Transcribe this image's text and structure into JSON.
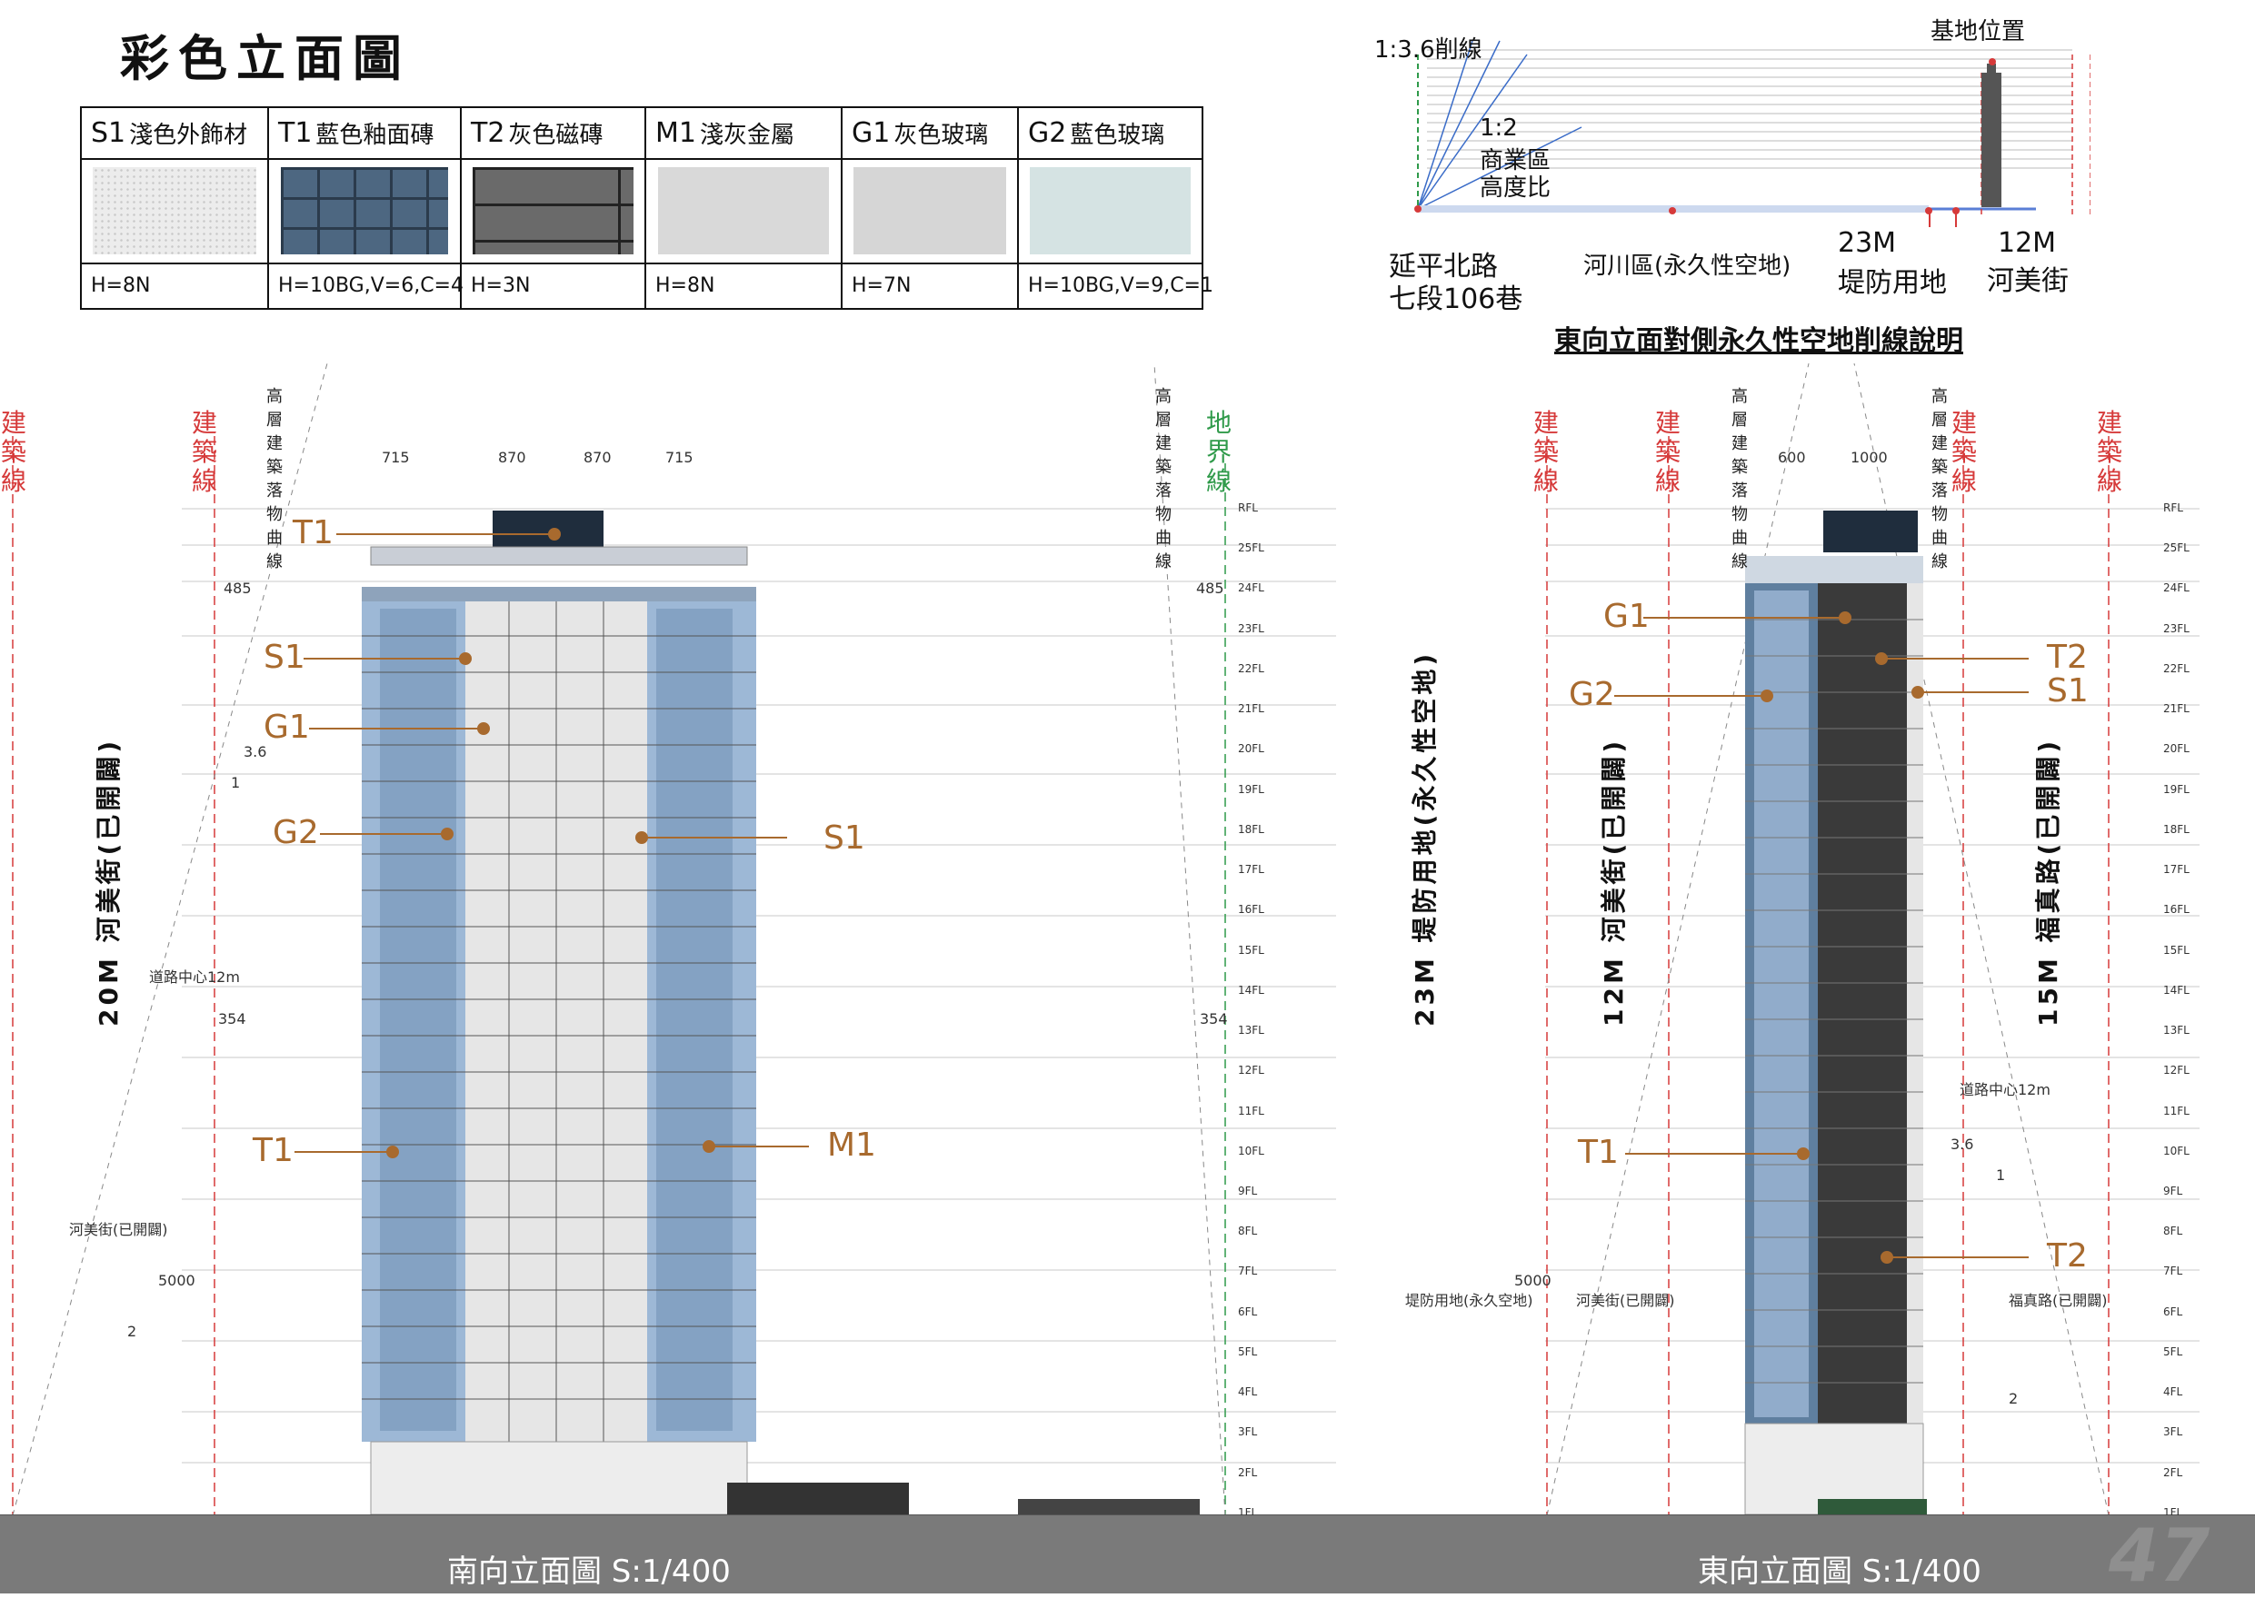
{
  "title": "彩色立面圖",
  "materials": [
    {
      "code": "S1",
      "name": "淺色外飾材",
      "spec": "H=8N",
      "swatch": "light-textured-stone",
      "color": "#ececec"
    },
    {
      "code": "T1",
      "name": "藍色釉面磚",
      "spec": "H=10BG,V=6,C=4",
      "swatch": "blue-glazed-tile",
      "color": "#4d6781"
    },
    {
      "code": "T2",
      "name": "灰色磁磚",
      "spec": "H=3N",
      "swatch": "grey-tile",
      "color": "#6a6a6a"
    },
    {
      "code": "M1",
      "name": "淺灰金屬",
      "spec": "H=8N",
      "swatch": "light-grey-metal",
      "color": "#d9d9d9"
    },
    {
      "code": "G1",
      "name": "灰色玻璃",
      "spec": "H=7N",
      "swatch": "grey-glass",
      "color": "#d6d6d6"
    },
    {
      "code": "G2",
      "name": "藍色玻璃",
      "spec": "H=10BG,V=9,C=1",
      "swatch": "blue-glass",
      "color": "#d5e3e3"
    }
  ],
  "inset": {
    "caption": "東向立面對側永久性空地削線說明",
    "ratio_36": "1:3.6削線",
    "ratio_2": "1:2",
    "commercial_1": "商業區",
    "commercial_2": "高度比",
    "site": "基地位置",
    "road_1": "延平北路",
    "road_2": "七段106巷",
    "river": "河川區(永久性空地)",
    "dike_width": "23M",
    "dike": "堤防用地",
    "street_width": "12M",
    "street": "河美街"
  },
  "labels": {
    "building_line": "建築線",
    "boundary_line": "地界線",
    "tallest_curve": "高層建築落物曲線",
    "street_20m": "20M 河美街(已開闢)",
    "dike_23m": "23M 堤防用地(永久性空地)",
    "street_12m": "12M 河美街(已開闢)",
    "road_15m": "15M 福真路(已開闢)",
    "small_street": "河美街(已開闢)",
    "small_dike": "堤防用地(永久空地)",
    "small_street2": "河美街(已開闢)",
    "small_road": "福真路(已開闢)",
    "dim_5000": "5000",
    "dim_715": "715",
    "dim_870": "870",
    "dim_600": "600",
    "dim_1000": "1000",
    "dim_485": "485",
    "dim_354": "354",
    "ratio_36": "3.6",
    "ratio_1": "1",
    "ratio_2": "2",
    "road_center": "道路中心12m"
  },
  "callouts": {
    "t1": "T1",
    "s1": "S1",
    "g1": "G1",
    "g2": "G2",
    "m1": "M1",
    "t2": "T2"
  },
  "floors": [
    "RFL",
    "25FL",
    "24FL",
    "23FL",
    "22FL",
    "21FL",
    "20FL",
    "19FL",
    "18FL",
    "17FL",
    "16FL",
    "15FL",
    "14FL",
    "13FL",
    "12FL",
    "11FL",
    "10FL",
    "9FL",
    "8FL",
    "7FL",
    "6FL",
    "5FL",
    "4FL",
    "3FL",
    "2FL",
    "1FL"
  ],
  "south_title": "南向立面圖   S:1/400",
  "east_title": "東向立面圖   S:1/400",
  "page_number": "47"
}
